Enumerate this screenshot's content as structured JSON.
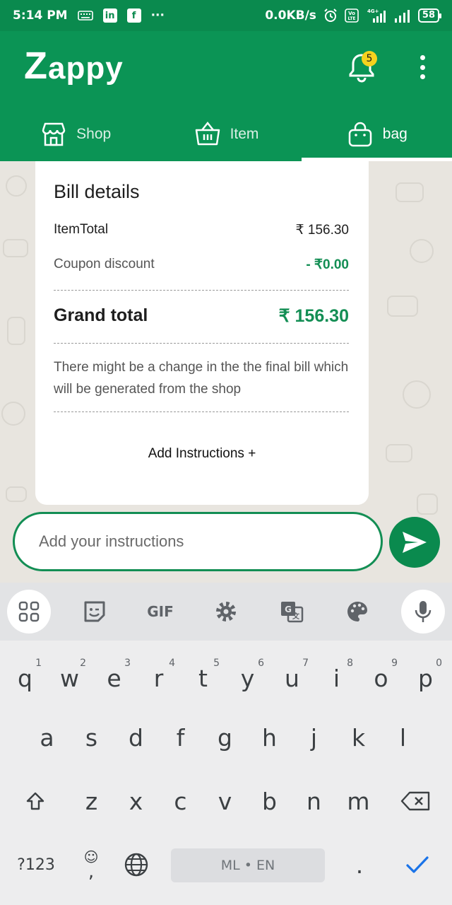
{
  "status_bar": {
    "time": "5:14 PM",
    "speed": "0.0KB/s",
    "battery": "58",
    "network_label": "4G+",
    "volte": "Vo LTE",
    "linkedin": "in",
    "facebook": "f",
    "dots": "···"
  },
  "app": {
    "logo_first": "Z",
    "logo_rest": "appy",
    "notification_count": "5"
  },
  "tabs": [
    {
      "label": "Shop",
      "icon": "shop-icon",
      "active": false
    },
    {
      "label": "Item",
      "icon": "basket-icon",
      "active": false
    },
    {
      "label": "bag",
      "icon": "bag-icon",
      "active": true
    }
  ],
  "bill": {
    "title": "Bill details",
    "item_total_label": "ItemTotal",
    "item_total_value": "₹ 156.30",
    "coupon_label": "Coupon discount",
    "coupon_value": "- ₹0.00",
    "grand_label": "Grand total",
    "grand_value": "₹ 156.30",
    "note": "There might be a change in the the final bill which will be generated from the shop",
    "add_instructions": "Add Instructions +"
  },
  "input": {
    "placeholder": "Add your instructions",
    "value": ""
  },
  "keyboard": {
    "toolbar": [
      "apps-icon",
      "sticker-icon",
      "GIF",
      "settings-icon",
      "translate-icon",
      "palette-icon",
      "mic-icon"
    ],
    "gif_label": "GIF",
    "row1": [
      {
        "k": "q",
        "h": "1"
      },
      {
        "k": "w",
        "h": "2"
      },
      {
        "k": "e",
        "h": "3"
      },
      {
        "k": "r",
        "h": "4"
      },
      {
        "k": "t",
        "h": "5"
      },
      {
        "k": "y",
        "h": "6"
      },
      {
        "k": "u",
        "h": "7"
      },
      {
        "k": "i",
        "h": "8"
      },
      {
        "k": "o",
        "h": "9"
      },
      {
        "k": "p",
        "h": "0"
      }
    ],
    "row2": [
      "a",
      "s",
      "d",
      "f",
      "g",
      "h",
      "j",
      "k",
      "l"
    ],
    "row3": [
      "z",
      "x",
      "c",
      "v",
      "b",
      "n",
      "m"
    ],
    "sym_label": "?123",
    "emoji_comma": ",",
    "space_label": "ML • EN",
    "period": "."
  },
  "colors": {
    "primary": "#0b9455",
    "status_bar": "#0a8a4e",
    "accent_green": "#138e54",
    "badge": "#f6d21e"
  }
}
